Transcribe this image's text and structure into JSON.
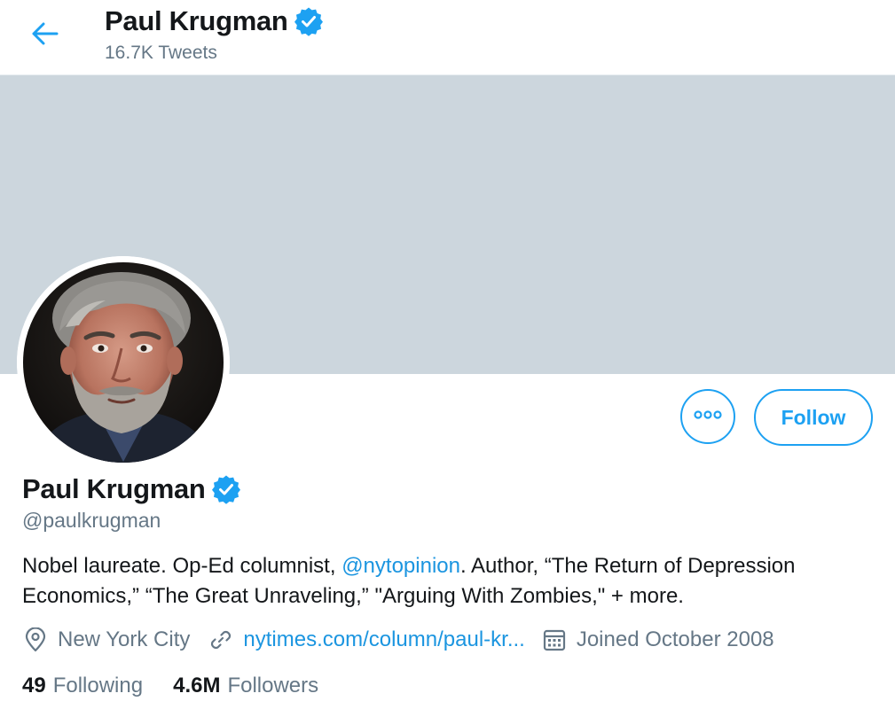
{
  "header": {
    "name": "Paul Krugman",
    "tweets_count": "16.7K Tweets",
    "back_icon": "arrow-left-icon",
    "verified_icon": "verified-badge-icon"
  },
  "banner": {
    "color": "#ccd6dd"
  },
  "profile": {
    "name": "Paul Krugman",
    "handle": "@paulkrugman",
    "bio_part1": "Nobel laureate. Op-Ed columnist, ",
    "bio_mention": "@nytopinion",
    "bio_part2": ". Author, “The Return of Depression Economics,” “The Great Unraveling,” \"Arguing With Zombies,\"  + more.",
    "location": "New York City",
    "website": "nytimes.com/column/paul-kr...",
    "joined": "Joined October 2008",
    "following_count": "49",
    "following_label": "Following",
    "followers_count": "4.6M",
    "followers_label": "Followers"
  },
  "actions": {
    "more_icon": "more-horizontal-icon",
    "follow_label": "Follow"
  },
  "colors": {
    "accent": "#1da1f2",
    "link": "#1b95e0",
    "secondary_text": "#657786",
    "primary_text": "#14171a"
  }
}
